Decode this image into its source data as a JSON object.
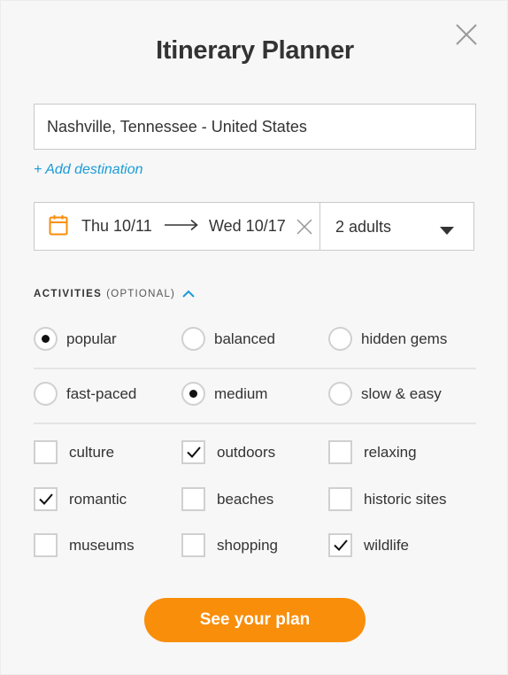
{
  "header": {
    "title": "Itinerary Planner"
  },
  "destination": {
    "value": "Nashville, Tennessee - United States",
    "add_label": "+ Add destination"
  },
  "dates": {
    "from": "Thu 10/11",
    "to": "Wed 10/17"
  },
  "guests": {
    "value": "2 adults"
  },
  "activities": {
    "title": "ACTIVITIES",
    "subtitle": "(OPTIONAL)",
    "popularity": [
      {
        "label": "popular",
        "selected": true
      },
      {
        "label": "balanced",
        "selected": false
      },
      {
        "label": "hidden gems",
        "selected": false
      }
    ],
    "pace": [
      {
        "label": "fast-paced",
        "selected": false
      },
      {
        "label": "medium",
        "selected": true
      },
      {
        "label": "slow & easy",
        "selected": false
      }
    ],
    "interests": [
      {
        "label": "culture",
        "checked": false
      },
      {
        "label": "outdoors",
        "checked": true
      },
      {
        "label": "relaxing",
        "checked": false
      },
      {
        "label": "romantic",
        "checked": true
      },
      {
        "label": "beaches",
        "checked": false
      },
      {
        "label": "historic sites",
        "checked": false
      },
      {
        "label": "museums",
        "checked": false
      },
      {
        "label": "shopping",
        "checked": false
      },
      {
        "label": "wildlife",
        "checked": true
      }
    ]
  },
  "cta": {
    "label": "See your plan"
  },
  "colors": {
    "accent": "#f98e0a",
    "link": "#1a9bd7"
  },
  "icons": {
    "close": "close-icon",
    "calendar": "calendar-icon",
    "arrow": "arrow-right-icon",
    "clear": "clear-icon",
    "caret": "caret-down-icon",
    "collapse": "chevron-up-icon",
    "check": "checkmark-icon"
  }
}
